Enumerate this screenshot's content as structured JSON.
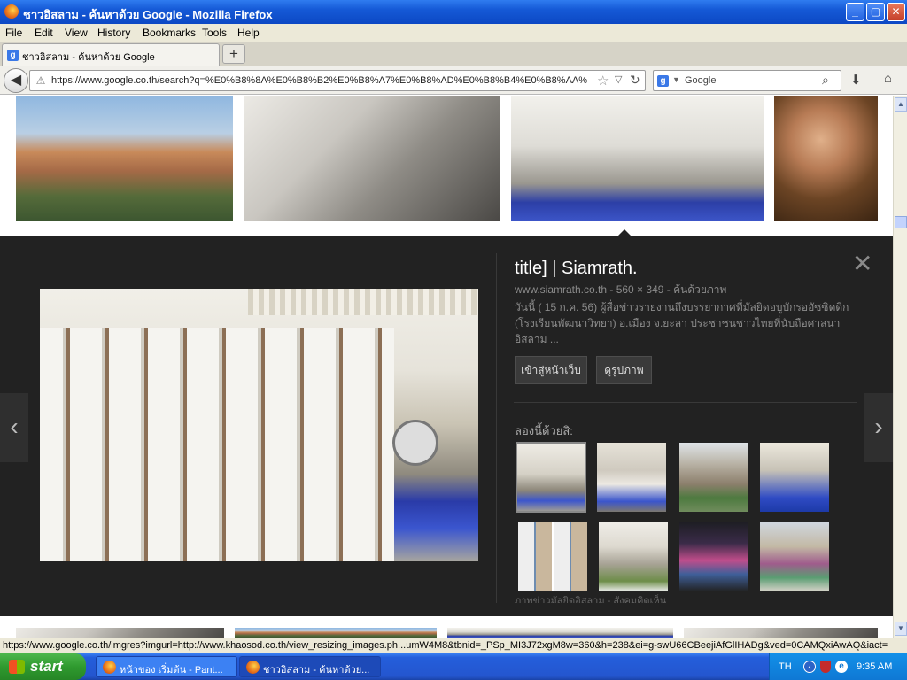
{
  "window": {
    "title": "ชาวอิสลาม - ค้นหาด้วย Google - Mozilla Firefox",
    "minimize": "_",
    "maximize": "▢",
    "close": "✕"
  },
  "menu": {
    "file": "File",
    "edit": "Edit",
    "view": "View",
    "history": "History",
    "bookmarks": "Bookmarks",
    "tools": "Tools",
    "help": "Help"
  },
  "tab": {
    "label": "ชาวอิสลาม - ค้นหาด้วย Google",
    "favicon": "g",
    "new_tab": "+"
  },
  "nav": {
    "url": "https://www.google.co.th/search?q=%E0%B8%8A%E0%B8%B2%E0%B8%A7%E0%B8%AD%E0%B8%B4%E0%B8%AA%",
    "search_placeholder": "Google",
    "search_favicon": "g"
  },
  "panel": {
    "title": "title] | Siamrath.",
    "meta": "www.siamrath.co.th - 560 × 349 - ค้นด้วยภาพ",
    "description": "วันนี้ ( 15 ก.ค. 56) ผู้สื่อข่าวรายงานถึงบรรยากาศที่มัสยิดอบูบักรออัซซิดดิก (โรงเรียนพัฒนาวิทยา) อ.เมือง จ.ยะลา ประชาชนชาวไทยที่นับถือศาสนาอิสลาม ...",
    "visit_button": "เข้าสู่หน้าเว็บ",
    "view_button": "ดูรูปภาพ",
    "related_label": "ลองนี้ด้วยสิ:",
    "related_caption": "ภาพข่าวมัสยิดอิสลาม - สังคมคิดเห็น",
    "close": "✕",
    "prev": "‹",
    "next": "›"
  },
  "status": {
    "text": "https://www.google.co.th/imgres?imgurl=http://www.khaosod.co.th/view_resizing_images.ph...umW4M8&tbnid=_PSp_MI3J72xgM8w=360&h=238&ei=g-swU66CBeejiAfGlIHADg&ved=0CAMQxiAwAQ&iact=c"
  },
  "taskbar": {
    "start": "start",
    "item1": "หน้าของ เริ่มต้น - Pant...",
    "item2": "ชาวอิสลาม - ค้นหาด้วย...",
    "lang": "TH",
    "clock": "9:35 AM"
  },
  "colors": {
    "panel_bg": "#222222",
    "title_bar": "#1559d6",
    "taskbar": "#245edb",
    "start_green": "#2f9a2f"
  }
}
